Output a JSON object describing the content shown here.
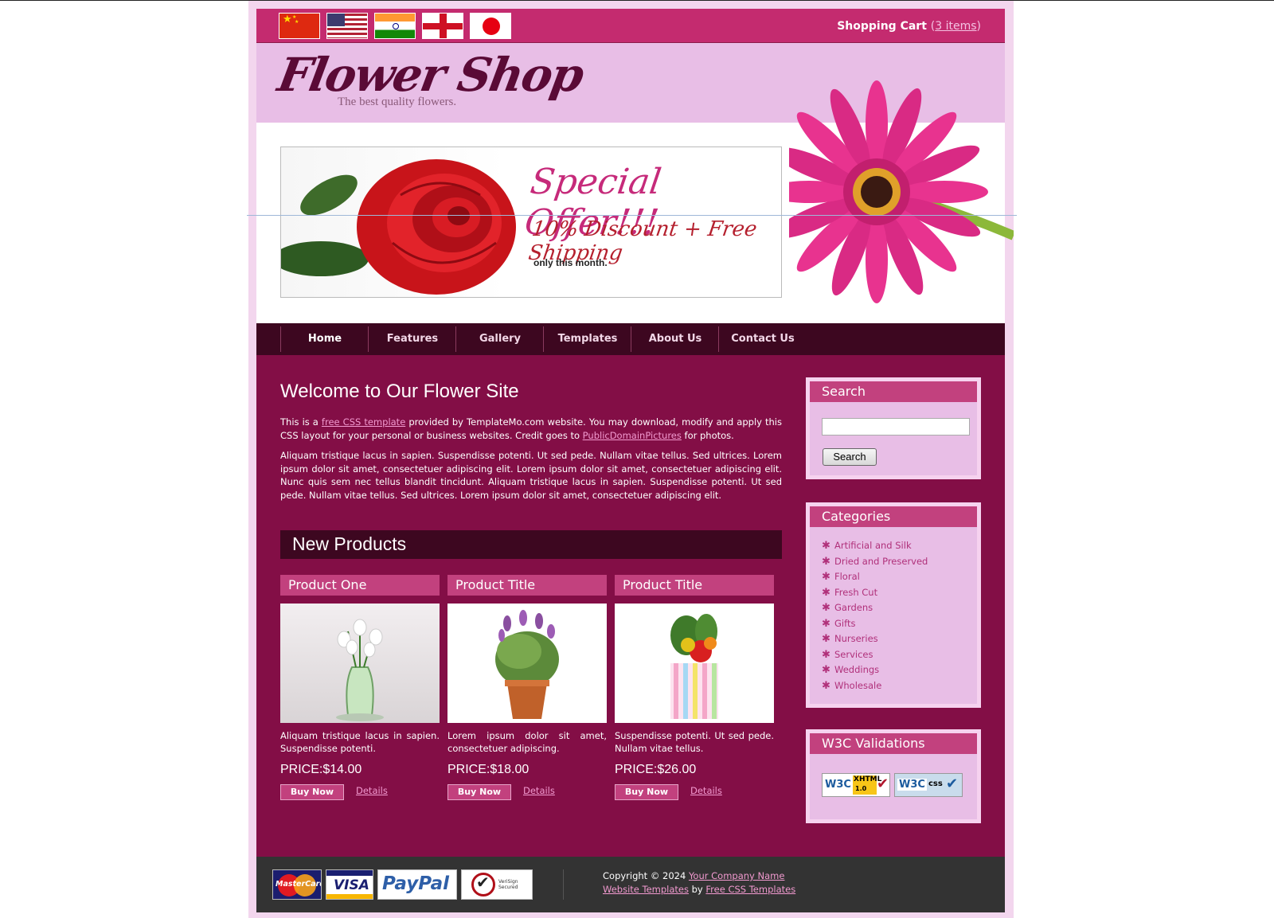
{
  "topbar": {
    "flags": [
      "china-flag-icon",
      "usa-flag-icon",
      "india-flag-icon",
      "england-flag-icon",
      "japan-flag-icon"
    ],
    "cart_label": "Shopping Cart",
    "cart_open": "(",
    "cart_items": "3 items",
    "cart_close": ")"
  },
  "header": {
    "logo_title": "Flower Shop",
    "logo_tagline": "The best quality flowers."
  },
  "banner": {
    "offer_title": "Special Offer!!!",
    "offer_subtitle": "10% Discount + Free Shipping",
    "offer_note": "only this month."
  },
  "nav": {
    "items": [
      "Home",
      "Features",
      "Gallery",
      "Templates",
      "About Us",
      "Contact Us"
    ]
  },
  "welcome": {
    "title": "Welcome to Our Flower Site",
    "p1_before": "This is a ",
    "p1_link1": "free CSS template",
    "p1_middle": " provided by TemplateMo.com website. You may download, modify and apply this CSS layout for your personal or business websites. Credit goes to ",
    "p1_link2": "PublicDomainPictures",
    "p1_after": " for photos.",
    "p2": "Aliquam tristique lacus in sapien. Suspendisse potenti. Ut sed pede. Nullam vitae tellus. Sed ultrices. Lorem ipsum dolor sit amet, consectetuer adipiscing elit. Lorem ipsum dolor sit amet, consectetuer adipiscing elit. Nunc quis sem nec tellus blandit tincidunt. Aliquam tristique lacus in sapien. Suspendisse potenti. Ut sed pede. Nullam vitae tellus. Sed ultrices. Lorem ipsum dolor sit amet, consectetuer adipiscing elit."
  },
  "products": {
    "heading": "New Products",
    "items": [
      {
        "title": "Product One",
        "desc": "Aliquam tristique lacus in sapien. Suspendisse potenti.",
        "price": "PRICE:$14.00",
        "buy": "Buy Now",
        "details": "Details"
      },
      {
        "title": "Product Title",
        "desc": "Lorem ipsum dolor sit amet, consectetuer adipiscing.",
        "price": "PRICE:$18.00",
        "buy": "Buy Now",
        "details": "Details"
      },
      {
        "title": "Product Title",
        "desc": "Suspendisse potenti. Ut sed pede. Nullam vitae tellus.",
        "price": "PRICE:$26.00",
        "buy": "Buy Now",
        "details": "Details"
      }
    ]
  },
  "sidebar": {
    "search_title": "Search",
    "search_button": "Search",
    "search_value": "",
    "categories_title": "Categories",
    "categories": [
      "Artificial and Silk",
      "Dried and Preserved",
      "Floral",
      "Fresh Cut",
      "Gardens",
      "Gifts",
      "Nurseries",
      "Services",
      "Weddings",
      "Wholesale"
    ],
    "w3c_title": "W3C Validations",
    "w3c_xhtml": {
      "brand": "W3C",
      "label": "XHTML",
      "version": "1.0"
    },
    "w3c_css": {
      "brand": "W3C",
      "label": "css"
    }
  },
  "footer": {
    "cards": {
      "mastercard": "MasterCard",
      "visa": "VISA",
      "paypal": "PayPal",
      "verisign": "VeriSign Secured"
    },
    "copyright": "Copyright © 2024 ",
    "company_link": "Your Company Name",
    "templates_link": "Website Templates",
    "by": " by ",
    "free_link": "Free CSS Templates"
  },
  "colors": {
    "topbar": "#c42b6f",
    "header": "#e8bee6",
    "nav": "#3d0720",
    "main": "#830e46",
    "accent": "#c2417e",
    "link": "#f29ad0",
    "footer": "#333333"
  }
}
